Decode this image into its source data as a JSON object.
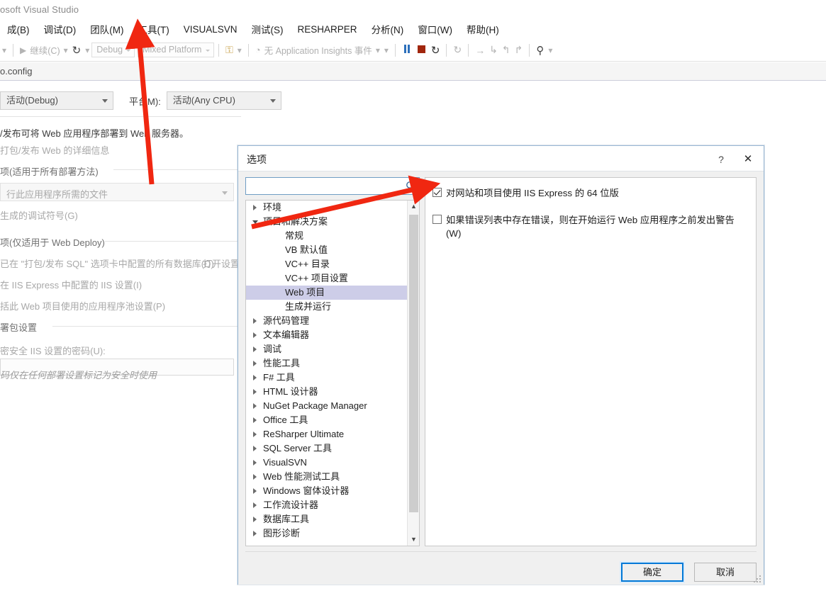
{
  "app": {
    "title": "osoft Visual Studio",
    "document_tab": "o.config"
  },
  "menubar": {
    "items": [
      {
        "label": "成(B)"
      },
      {
        "label": "调试(D)"
      },
      {
        "label": "团队(M)"
      },
      {
        "label": "工具(T)"
      },
      {
        "label": "VISUALSVN"
      },
      {
        "label": "测试(S)"
      },
      {
        "label": "RESHARPER"
      },
      {
        "label": "分析(N)"
      },
      {
        "label": "窗口(W)"
      },
      {
        "label": "帮助(H)"
      }
    ]
  },
  "toolbar": {
    "continue_label": "继续(C)",
    "config_combo": "Debug",
    "platform_combo": "Mixed Platform",
    "app_insights_label": "无 Application Insights 事件",
    "icons": {
      "play": "▶",
      "restart": "↻",
      "pause": "pause-icon",
      "stop": "stop-icon",
      "reload": "↻",
      "step_over": "→",
      "step_into": "↳",
      "step_out": "↰",
      "step_next": "↱",
      "breakpoints": "⚲"
    }
  },
  "background_page": {
    "configuration_value": "活动(Debug)",
    "platform_label": "平台M):",
    "platform_value": "活动(Any CPU)",
    "intro_text": "/发布可将 Web 应用程序部署到 Web 服务器。",
    "link_text": "打包/发布 Web 的详细信息",
    "section1_title": "项(适用于所有部署方法)",
    "files_combo": "行此应用程序所需的文件",
    "pdb_checkbox": "生成的调试符号(G)",
    "section2_title": "项(仅适用于 Web Deploy)",
    "db_option": "已在 \"打包/发布 SQL\" 选项卡中配置的所有数据库(D)",
    "db_link": "打开设置",
    "iis_option": "在 IIS Express 中配置的 IIS 设置(I)",
    "apppool_option": "括此 Web 项目使用的应用程序池设置(P)",
    "section3_title": "署包设置",
    "password_label": "密安全 IIS 设置的密码(U):",
    "password_hint": "码仅在任何部署设置标记为安全时使用"
  },
  "dialog": {
    "title": "选项",
    "help_glyph": "?",
    "close_glyph": "✕",
    "search": {
      "value": "",
      "placeholder": ""
    },
    "tree": [
      {
        "label": "环境",
        "level": 0,
        "expandable": true,
        "expanded": false,
        "selected": false
      },
      {
        "label": "项目和解决方案",
        "level": 0,
        "expandable": true,
        "expanded": true,
        "selected": false
      },
      {
        "label": "常规",
        "level": 1,
        "expandable": false,
        "expanded": false,
        "selected": false
      },
      {
        "label": "VB 默认值",
        "level": 1,
        "expandable": false,
        "expanded": false,
        "selected": false
      },
      {
        "label": "VC++ 目录",
        "level": 1,
        "expandable": false,
        "expanded": false,
        "selected": false
      },
      {
        "label": "VC++ 项目设置",
        "level": 1,
        "expandable": false,
        "expanded": false,
        "selected": false
      },
      {
        "label": "Web 项目",
        "level": 1,
        "expandable": false,
        "expanded": false,
        "selected": true
      },
      {
        "label": "生成并运行",
        "level": 1,
        "expandable": false,
        "expanded": false,
        "selected": false
      },
      {
        "label": "源代码管理",
        "level": 0,
        "expandable": true,
        "expanded": false,
        "selected": false
      },
      {
        "label": "文本编辑器",
        "level": 0,
        "expandable": true,
        "expanded": false,
        "selected": false
      },
      {
        "label": "调试",
        "level": 0,
        "expandable": true,
        "expanded": false,
        "selected": false
      },
      {
        "label": "性能工具",
        "level": 0,
        "expandable": true,
        "expanded": false,
        "selected": false
      },
      {
        "label": "F# 工具",
        "level": 0,
        "expandable": true,
        "expanded": false,
        "selected": false
      },
      {
        "label": "HTML 设计器",
        "level": 0,
        "expandable": true,
        "expanded": false,
        "selected": false
      },
      {
        "label": "NuGet Package Manager",
        "level": 0,
        "expandable": true,
        "expanded": false,
        "selected": false
      },
      {
        "label": "Office 工具",
        "level": 0,
        "expandable": true,
        "expanded": false,
        "selected": false
      },
      {
        "label": "ReSharper Ultimate",
        "level": 0,
        "expandable": true,
        "expanded": false,
        "selected": false
      },
      {
        "label": "SQL Server 工具",
        "level": 0,
        "expandable": true,
        "expanded": false,
        "selected": false
      },
      {
        "label": "VisualSVN",
        "level": 0,
        "expandable": true,
        "expanded": false,
        "selected": false
      },
      {
        "label": "Web 性能测试工具",
        "level": 0,
        "expandable": true,
        "expanded": false,
        "selected": false
      },
      {
        "label": "Windows 窗体设计器",
        "level": 0,
        "expandable": true,
        "expanded": false,
        "selected": false
      },
      {
        "label": "工作流设计器",
        "level": 0,
        "expandable": true,
        "expanded": false,
        "selected": false
      },
      {
        "label": "数据库工具",
        "level": 0,
        "expandable": true,
        "expanded": false,
        "selected": false
      },
      {
        "label": "图形诊断",
        "level": 0,
        "expandable": true,
        "expanded": false,
        "selected": false
      }
    ],
    "options": [
      {
        "label": "对网站和项目使用 IIS Express 的 64 位版",
        "checked": true
      },
      {
        "label": "如果错误列表中存在错误，则在开始运行 Web 应用程序之前发出警告(W)",
        "checked": false
      }
    ],
    "buttons": {
      "ok": "确定",
      "cancel": "取消"
    }
  },
  "annotations": {
    "arrow_color": "#f02711",
    "arrow_tools_menu": "points-to-tools-menu",
    "arrow_iis_checkbox": "points-to-iis-express-64bit-checkbox"
  }
}
